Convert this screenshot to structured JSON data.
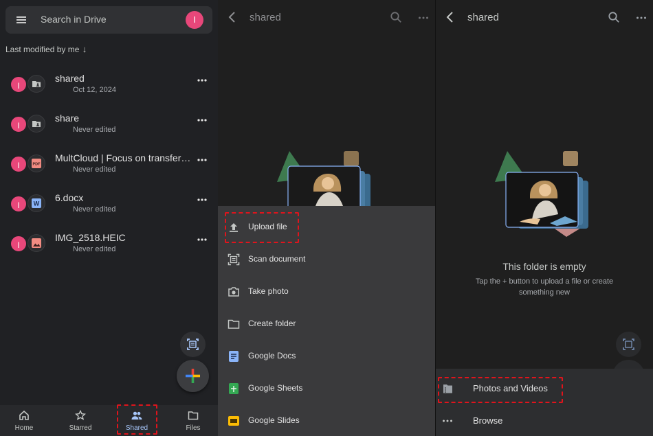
{
  "left": {
    "search_placeholder": "Search in Drive",
    "avatar_initial": "I",
    "sort_label": "Last modified by me",
    "sort_arrow": "↓",
    "files": [
      {
        "name": "shared",
        "subtitle": "Oct 12, 2024",
        "owner": "I",
        "icon": "shared-folder-icon"
      },
      {
        "name": "share",
        "subtitle": "Never edited",
        "owner": "I",
        "icon": "shared-folder-icon"
      },
      {
        "name": "MultCloud | Focus on transferri...",
        "subtitle": "Never edited",
        "owner": "I",
        "icon": "pdf-icon"
      },
      {
        "name": "6.docx",
        "subtitle": "Never edited",
        "owner": "I",
        "icon": "word-doc-icon"
      },
      {
        "name": "IMG_2518.HEIC",
        "subtitle": "Never edited",
        "owner": "I",
        "icon": "image-icon"
      }
    ],
    "nav": [
      {
        "label": "Home",
        "icon": "home-icon"
      },
      {
        "label": "Starred",
        "icon": "star-icon"
      },
      {
        "label": "Shared",
        "icon": "people-icon",
        "active": true
      },
      {
        "label": "Files",
        "icon": "folder-icon"
      }
    ]
  },
  "middle": {
    "title": "shared",
    "menu": [
      {
        "label": "Upload file",
        "icon": "upload-icon"
      },
      {
        "label": "Scan document",
        "icon": "scan-icon"
      },
      {
        "label": "Take photo",
        "icon": "camera-icon"
      },
      {
        "label": "Create folder",
        "icon": "folder-icon"
      },
      {
        "label": "Google Docs",
        "icon": "google-docs-icon"
      },
      {
        "label": "Google Sheets",
        "icon": "google-sheets-icon"
      },
      {
        "label": "Google Slides",
        "icon": "google-slides-icon"
      }
    ]
  },
  "right": {
    "title": "shared",
    "empty_title": "This folder is empty",
    "empty_subtitle": "Tap the + button to upload a file or create something new",
    "options": [
      {
        "label": "Photos and Videos",
        "icon": "photos-icon"
      },
      {
        "label": "Browse",
        "icon": "more-horiz-icon"
      }
    ]
  },
  "colors": {
    "accent": "#a8c7fa",
    "avatar": "#e8477a",
    "highlight": "#e0141c"
  }
}
